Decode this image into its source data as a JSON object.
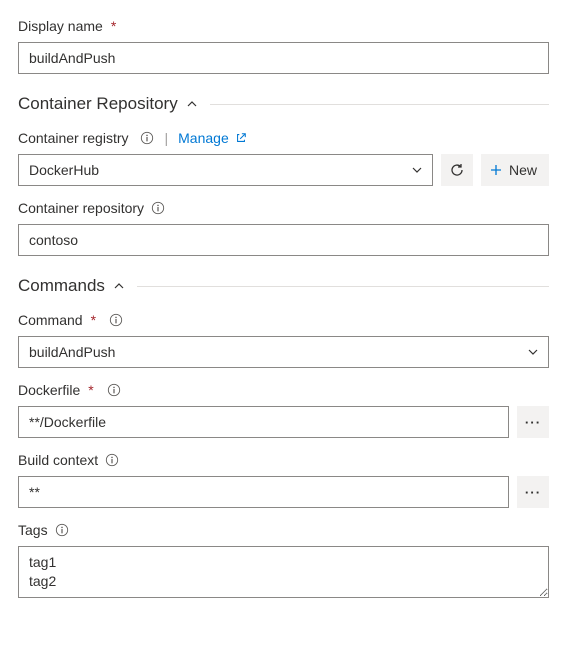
{
  "displayName": {
    "label": "Display name",
    "required": true,
    "value": "buildAndPush"
  },
  "sections": {
    "containerRepository": {
      "title": "Container Repository"
    },
    "commands": {
      "title": "Commands"
    }
  },
  "containerRegistry": {
    "label": "Container registry",
    "manageLabel": "Manage",
    "value": "DockerHub",
    "newLabel": "New"
  },
  "containerRepositoryField": {
    "label": "Container repository",
    "value": "contoso"
  },
  "command": {
    "label": "Command",
    "required": true,
    "value": "buildAndPush"
  },
  "dockerfile": {
    "label": "Dockerfile",
    "required": true,
    "value": "**/Dockerfile"
  },
  "buildContext": {
    "label": "Build context",
    "value": "**"
  },
  "tags": {
    "label": "Tags",
    "value": "tag1\ntag2"
  }
}
